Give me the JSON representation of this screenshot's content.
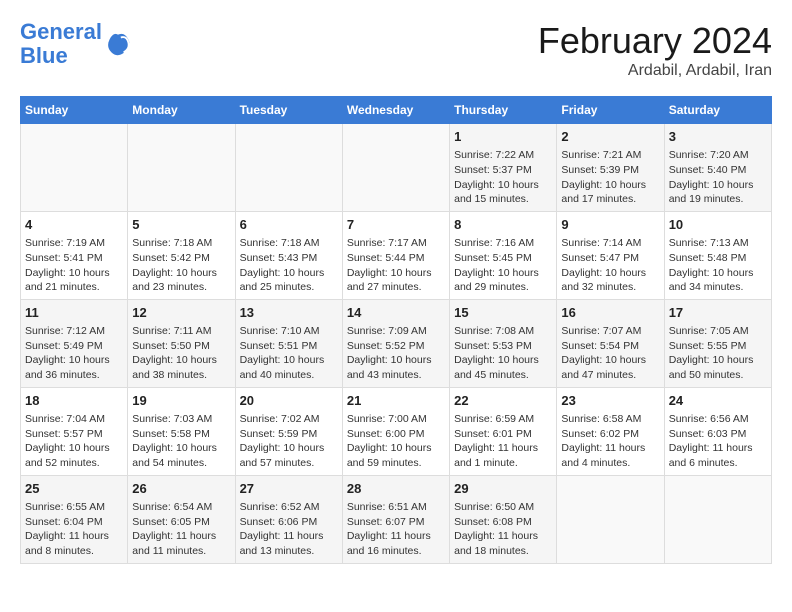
{
  "header": {
    "logo_line1": "General",
    "logo_line2": "Blue",
    "title": "February 2024",
    "subtitle": "Ardabil, Ardabil, Iran"
  },
  "days_of_week": [
    "Sunday",
    "Monday",
    "Tuesday",
    "Wednesday",
    "Thursday",
    "Friday",
    "Saturday"
  ],
  "weeks": [
    [
      {
        "day": "",
        "info": ""
      },
      {
        "day": "",
        "info": ""
      },
      {
        "day": "",
        "info": ""
      },
      {
        "day": "",
        "info": ""
      },
      {
        "day": "1",
        "info": "Sunrise: 7:22 AM\nSunset: 5:37 PM\nDaylight: 10 hours\nand 15 minutes."
      },
      {
        "day": "2",
        "info": "Sunrise: 7:21 AM\nSunset: 5:39 PM\nDaylight: 10 hours\nand 17 minutes."
      },
      {
        "day": "3",
        "info": "Sunrise: 7:20 AM\nSunset: 5:40 PM\nDaylight: 10 hours\nand 19 minutes."
      }
    ],
    [
      {
        "day": "4",
        "info": "Sunrise: 7:19 AM\nSunset: 5:41 PM\nDaylight: 10 hours\nand 21 minutes."
      },
      {
        "day": "5",
        "info": "Sunrise: 7:18 AM\nSunset: 5:42 PM\nDaylight: 10 hours\nand 23 minutes."
      },
      {
        "day": "6",
        "info": "Sunrise: 7:18 AM\nSunset: 5:43 PM\nDaylight: 10 hours\nand 25 minutes."
      },
      {
        "day": "7",
        "info": "Sunrise: 7:17 AM\nSunset: 5:44 PM\nDaylight: 10 hours\nand 27 minutes."
      },
      {
        "day": "8",
        "info": "Sunrise: 7:16 AM\nSunset: 5:45 PM\nDaylight: 10 hours\nand 29 minutes."
      },
      {
        "day": "9",
        "info": "Sunrise: 7:14 AM\nSunset: 5:47 PM\nDaylight: 10 hours\nand 32 minutes."
      },
      {
        "day": "10",
        "info": "Sunrise: 7:13 AM\nSunset: 5:48 PM\nDaylight: 10 hours\nand 34 minutes."
      }
    ],
    [
      {
        "day": "11",
        "info": "Sunrise: 7:12 AM\nSunset: 5:49 PM\nDaylight: 10 hours\nand 36 minutes."
      },
      {
        "day": "12",
        "info": "Sunrise: 7:11 AM\nSunset: 5:50 PM\nDaylight: 10 hours\nand 38 minutes."
      },
      {
        "day": "13",
        "info": "Sunrise: 7:10 AM\nSunset: 5:51 PM\nDaylight: 10 hours\nand 40 minutes."
      },
      {
        "day": "14",
        "info": "Sunrise: 7:09 AM\nSunset: 5:52 PM\nDaylight: 10 hours\nand 43 minutes."
      },
      {
        "day": "15",
        "info": "Sunrise: 7:08 AM\nSunset: 5:53 PM\nDaylight: 10 hours\nand 45 minutes."
      },
      {
        "day": "16",
        "info": "Sunrise: 7:07 AM\nSunset: 5:54 PM\nDaylight: 10 hours\nand 47 minutes."
      },
      {
        "day": "17",
        "info": "Sunrise: 7:05 AM\nSunset: 5:55 PM\nDaylight: 10 hours\nand 50 minutes."
      }
    ],
    [
      {
        "day": "18",
        "info": "Sunrise: 7:04 AM\nSunset: 5:57 PM\nDaylight: 10 hours\nand 52 minutes."
      },
      {
        "day": "19",
        "info": "Sunrise: 7:03 AM\nSunset: 5:58 PM\nDaylight: 10 hours\nand 54 minutes."
      },
      {
        "day": "20",
        "info": "Sunrise: 7:02 AM\nSunset: 5:59 PM\nDaylight: 10 hours\nand 57 minutes."
      },
      {
        "day": "21",
        "info": "Sunrise: 7:00 AM\nSunset: 6:00 PM\nDaylight: 10 hours\nand 59 minutes."
      },
      {
        "day": "22",
        "info": "Sunrise: 6:59 AM\nSunset: 6:01 PM\nDaylight: 11 hours\nand 1 minute."
      },
      {
        "day": "23",
        "info": "Sunrise: 6:58 AM\nSunset: 6:02 PM\nDaylight: 11 hours\nand 4 minutes."
      },
      {
        "day": "24",
        "info": "Sunrise: 6:56 AM\nSunset: 6:03 PM\nDaylight: 11 hours\nand 6 minutes."
      }
    ],
    [
      {
        "day": "25",
        "info": "Sunrise: 6:55 AM\nSunset: 6:04 PM\nDaylight: 11 hours\nand 8 minutes."
      },
      {
        "day": "26",
        "info": "Sunrise: 6:54 AM\nSunset: 6:05 PM\nDaylight: 11 hours\nand 11 minutes."
      },
      {
        "day": "27",
        "info": "Sunrise: 6:52 AM\nSunset: 6:06 PM\nDaylight: 11 hours\nand 13 minutes."
      },
      {
        "day": "28",
        "info": "Sunrise: 6:51 AM\nSunset: 6:07 PM\nDaylight: 11 hours\nand 16 minutes."
      },
      {
        "day": "29",
        "info": "Sunrise: 6:50 AM\nSunset: 6:08 PM\nDaylight: 11 hours\nand 18 minutes."
      },
      {
        "day": "",
        "info": ""
      },
      {
        "day": "",
        "info": ""
      }
    ]
  ]
}
